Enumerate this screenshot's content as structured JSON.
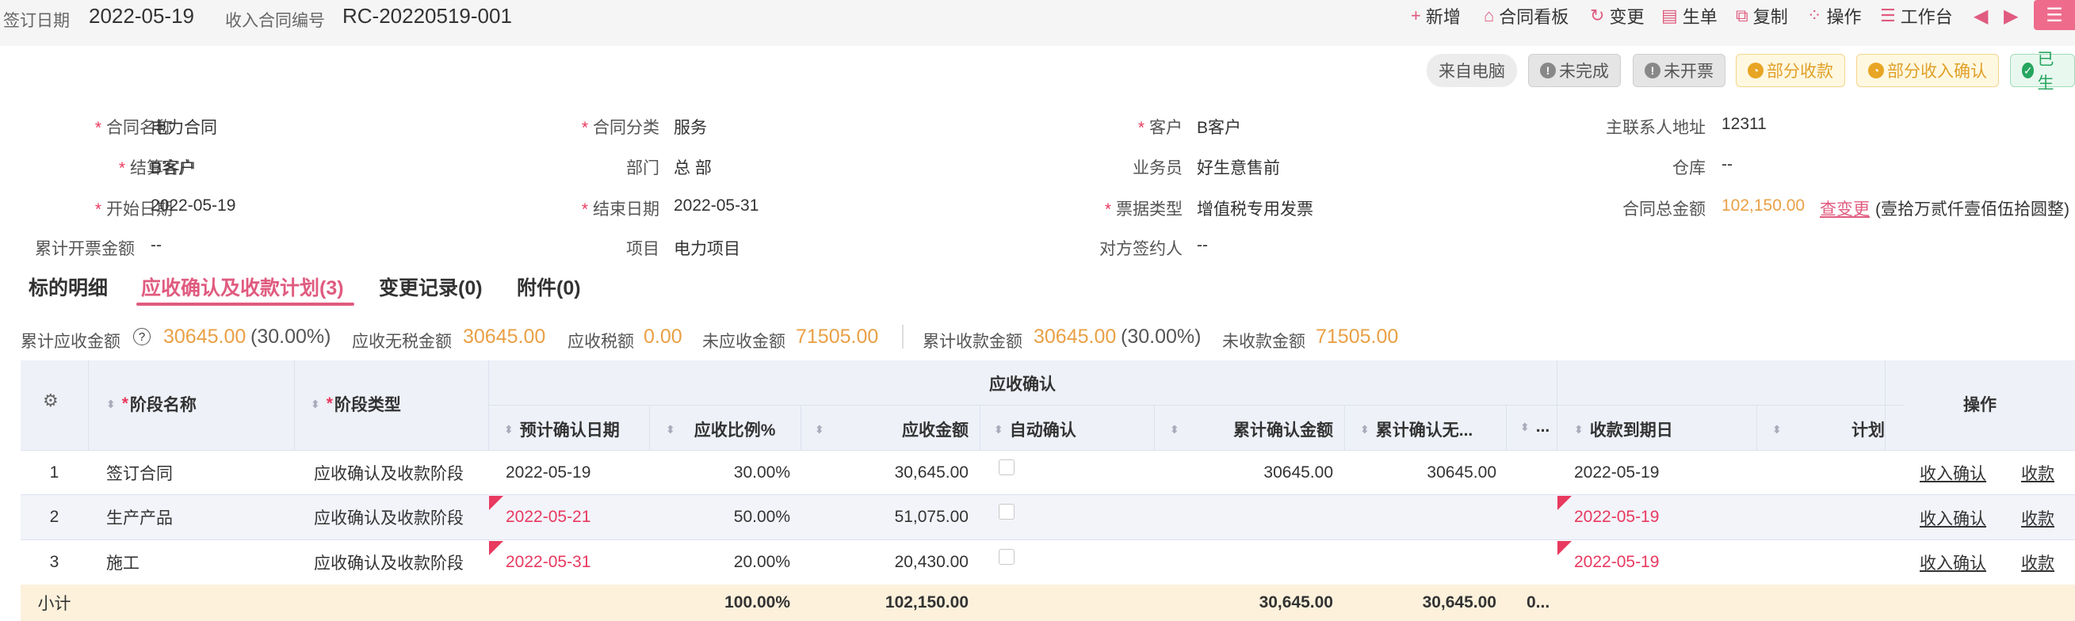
{
  "header": {
    "sign_date_label": "签订日期",
    "sign_date": "2022-05-19",
    "contract_no_label": "收入合同编号",
    "contract_no": "RC-20220519-001"
  },
  "toolbar": [
    {
      "icon": "plus-icon",
      "glyph": "+",
      "label": "新增"
    },
    {
      "icon": "contract-board-icon",
      "glyph": "⌂",
      "label": "合同看板"
    },
    {
      "icon": "change-icon",
      "glyph": "↻",
      "label": "变更"
    },
    {
      "icon": "generate-doc-icon",
      "glyph": "▤",
      "label": "生单"
    },
    {
      "icon": "copy-icon",
      "glyph": "⧉",
      "label": "复制"
    },
    {
      "icon": "operate-icon",
      "glyph": "⁘",
      "label": "操作"
    },
    {
      "icon": "workbench-icon",
      "glyph": "☰",
      "label": "工作台"
    }
  ],
  "menu_glyph": "☰",
  "status_tags": [
    {
      "label": "来自电脑",
      "style": "src"
    },
    {
      "label": "未完成",
      "style": "grey",
      "glyph": "!"
    },
    {
      "label": "未开票",
      "style": "grey",
      "glyph": "!"
    },
    {
      "label": "部分收款",
      "style": "yel",
      "glyph": "◔"
    },
    {
      "label": "部分收入确认",
      "style": "yel",
      "glyph": "◔"
    },
    {
      "label": "已生",
      "style": "grn",
      "glyph": "✓"
    }
  ],
  "form": {
    "contract_name_label": "合同名称",
    "contract_name": "电力合同",
    "category_label": "合同分类",
    "category": "服务",
    "customer_label": "客户",
    "customer": "B客户",
    "contact_addr_label": "主联系人地址",
    "contact_addr": "12311",
    "settle_customer_label": "结算客户",
    "settle_customer": "B客户",
    "dept_label": "部门",
    "dept": "总 部",
    "salesman_label": "业务员",
    "salesman": "好生意售前",
    "warehouse_label": "仓库",
    "warehouse": "--",
    "start_date_label": "开始日期",
    "start_date": "2022-05-19",
    "end_date_label": "结束日期",
    "end_date": "2022-05-31",
    "invoice_type_label": "票据类型",
    "invoice_type": "增值税专用发票",
    "total_label": "合同总金额",
    "total": "102,150.00",
    "view_change": "查变更",
    "total_words": "(壹拾万贰仟壹佰伍拾圆整)",
    "invoiced_label": "累计开票金额",
    "invoiced": "--",
    "project_label": "项目",
    "project": "电力项目",
    "signer_label": "对方签约人",
    "signer": "--"
  },
  "tabs": [
    {
      "label": "标的明细"
    },
    {
      "label": "应收确认及收款计划(3)"
    },
    {
      "label": "变更记录(0)"
    },
    {
      "label": "附件(0)"
    }
  ],
  "summary": {
    "recv_label": "累计应收金额",
    "recv": "30645.00",
    "recv_pct": "(30.00%)",
    "notax_label": "应收无税金额",
    "notax": "30645.00",
    "tax_label": "应收税额",
    "tax": "0.00",
    "unrecv_label": "未应收金额",
    "unrecv": "71505.00",
    "collected_label": "累计收款金额",
    "collected": "30645.00",
    "collected_pct": "(30.00%)",
    "uncollected_label": "未收款金额",
    "uncollected": "71505.00"
  },
  "table": {
    "group_header": "应收确认",
    "op_header": "操作",
    "headers": {
      "stage_name": "阶段名称",
      "stage_type": "阶段类型",
      "plan_date": "预计确认日期",
      "ratio": "应收比例%",
      "amount": "应收金额",
      "auto": "自动确认",
      "cum_amount": "累计确认金额",
      "cum_notax": "累计确认无...",
      "more": "...",
      "due_date": "收款到期日",
      "plan": "计划"
    },
    "rows": [
      {
        "idx": "1",
        "name": "签订合同",
        "type": "应收确认及收款阶段",
        "plan_date": "2022-05-19",
        "ratio": "30.00%",
        "amount": "30,645.00",
        "cum_amount": "30645.00",
        "cum_notax": "30645.00",
        "due_date": "2022-05-19",
        "op1": "收入确认",
        "op2": "收款"
      },
      {
        "idx": "2",
        "name": "生产产品",
        "type": "应收确认及收款阶段",
        "plan_date": "2022-05-21",
        "ratio": "50.00%",
        "amount": "51,075.00",
        "cum_amount": "",
        "cum_notax": "",
        "due_date": "2022-05-19",
        "op1": "收入确认",
        "op2": "收款"
      },
      {
        "idx": "3",
        "name": "施工",
        "type": "应收确认及收款阶段",
        "plan_date": "2022-05-31",
        "ratio": "20.00%",
        "amount": "20,430.00",
        "cum_amount": "",
        "cum_notax": "",
        "due_date": "2022-05-19",
        "op1": "收入确认",
        "op2": "收款"
      }
    ],
    "subtotal": {
      "label": "小计",
      "ratio": "100.00%",
      "amount": "102,150.00",
      "cum_amount": "30,645.00",
      "cum_notax": "30,645.00",
      "more": "0..."
    }
  },
  "colors": {
    "accent": "#e05b7f",
    "orange": "#e9a045",
    "required": "#e8395f"
  }
}
